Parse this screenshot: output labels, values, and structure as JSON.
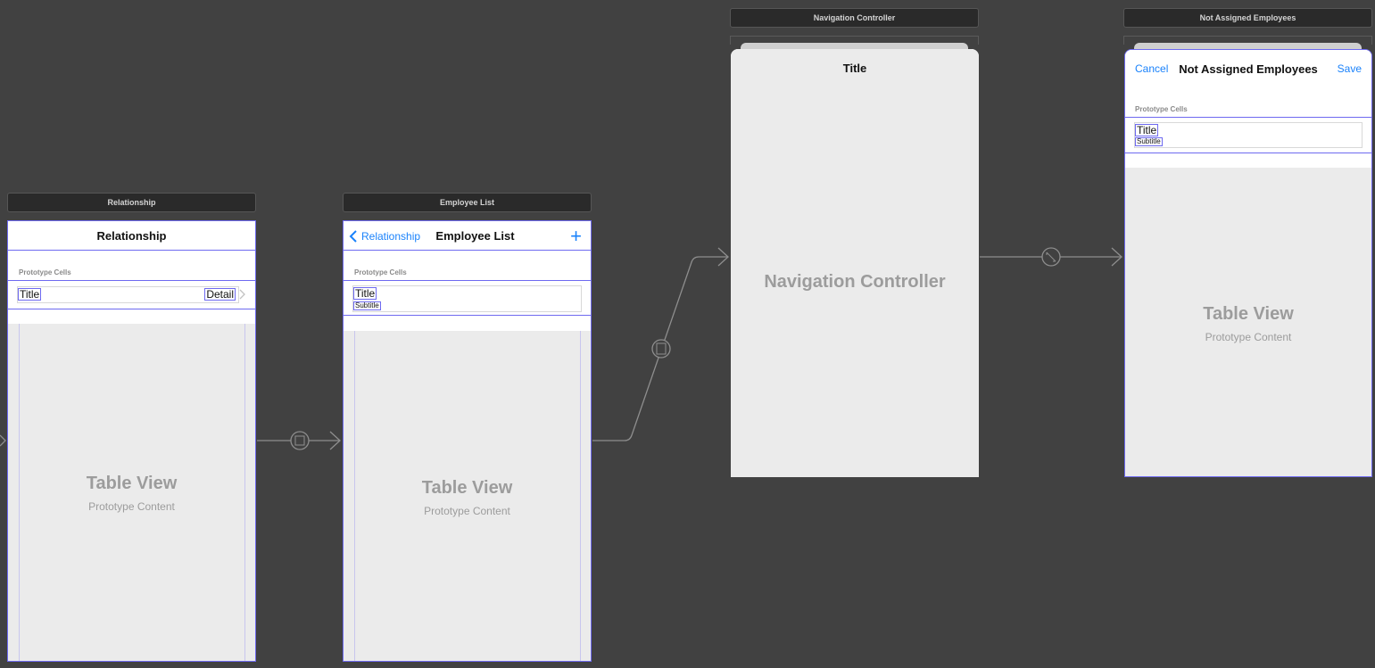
{
  "scenes": {
    "relationship": {
      "header": "Relationship",
      "nav_title": "Relationship",
      "proto_label": "Prototype Cells",
      "cell_title": "Title",
      "cell_detail": "Detail",
      "table_label": "Table View",
      "table_sub": "Prototype Content"
    },
    "employee_list": {
      "header": "Employee List",
      "nav_back": "Relationship",
      "nav_title": "Employee List",
      "nav_add": "+",
      "proto_label": "Prototype Cells",
      "cell_title": "Title",
      "cell_subtitle": "Subtitle",
      "table_label": "Table View",
      "table_sub": "Prototype Content"
    },
    "navigation_controller": {
      "header": "Navigation Controller",
      "nav_title": "Title",
      "center_label": "Navigation Controller"
    },
    "not_assigned": {
      "header": "Not Assigned Employees",
      "nav_cancel": "Cancel",
      "nav_title": "Not Assigned Employees",
      "nav_save": "Save",
      "proto_label": "Prototype Cells",
      "cell_title": "Title",
      "cell_subtitle": "Subtitle",
      "table_label": "Table View",
      "table_sub": "Prototype Content"
    }
  },
  "colors": {
    "canvas": "#414141",
    "selection": "#6e6af0",
    "link": "#1a82fb",
    "segue": "#8e8e8e"
  }
}
